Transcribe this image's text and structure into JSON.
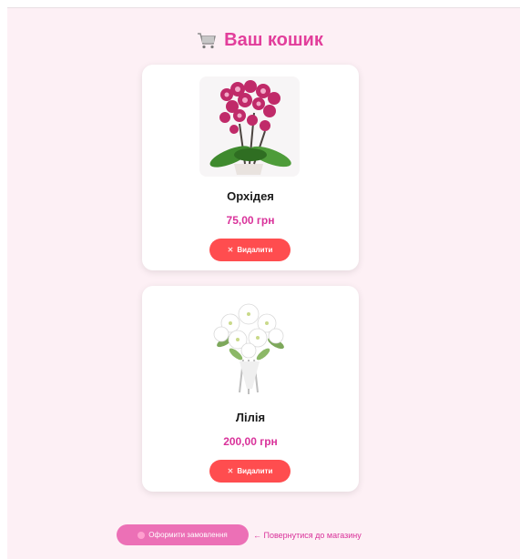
{
  "header": {
    "title": "Ваш кошик",
    "icon": "cart-icon"
  },
  "cart": {
    "items": [
      {
        "name": "Орхідея",
        "price": "75,00 грн",
        "remove_label": "Видалити",
        "image_icon": "orchid-image"
      },
      {
        "name": "Лілія",
        "price": "200,00 грн",
        "remove_label": "Видалити",
        "image_icon": "lily-image"
      }
    ]
  },
  "footer": {
    "checkout_label": "Оформити замовлення",
    "back_label": "← Повернутися до магазину"
  },
  "colors": {
    "background": "#fdf0f5",
    "accent": "#e23e9b",
    "remove_button": "#ff4d4f",
    "checkout_button": "#ec70b6"
  }
}
